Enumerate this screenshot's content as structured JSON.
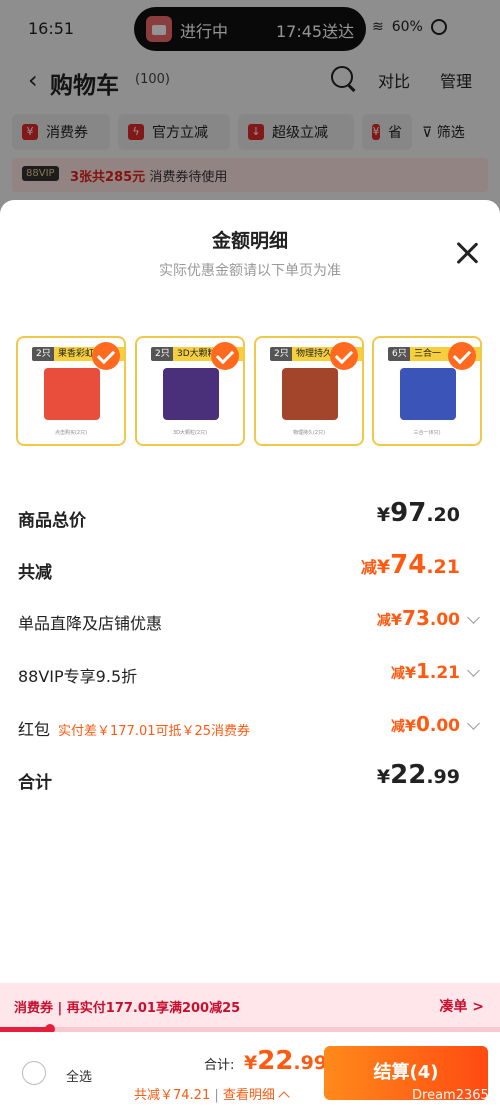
{
  "status_bar": {
    "time": "16:51",
    "live_status": "进行中",
    "eta": "17:45送达",
    "battery": "60%"
  },
  "nav": {
    "title": "购物车",
    "count": "(100)",
    "compare": "对比",
    "manage": "管理"
  },
  "filters": {
    "chips": [
      "消费券",
      "官方立减",
      "超级立减",
      "省"
    ],
    "filter_label": "筛选"
  },
  "vip_banner": {
    "tag": "88VIP",
    "highlight": "3张共285元",
    "text": "消费券待使用"
  },
  "sheet": {
    "title": "金额明细",
    "subtitle": "实际优惠金额请以下单页为准",
    "products": [
      {
        "qty": "2只",
        "name": "果香彩虹",
        "caption": "点击购买(2只)",
        "color": "#e94e3c"
      },
      {
        "qty": "2只",
        "name": "3D大颗粒",
        "caption": "3D大颗粒(2只)",
        "color": "#4a2f7a"
      },
      {
        "qty": "2只",
        "name": "物理持久",
        "caption": "物理持久(2只)",
        "color": "#a2452a"
      },
      {
        "qty": "6只",
        "name": "三合一",
        "caption": "三合一(6只)",
        "color": "#3a54b8"
      }
    ],
    "rows": [
      {
        "label": "商品总价",
        "prefix": "",
        "yen": "¥",
        "int": "97",
        "dec": ".20",
        "style": "dark"
      },
      {
        "label": "共减",
        "prefix": "减",
        "yen": "¥",
        "int": "74",
        "dec": ".21",
        "style": "orange"
      },
      {
        "label": "单品直降及店铺优惠",
        "prefix": "减",
        "yen": "¥",
        "int": "73",
        "dec": ".00",
        "style": "orange-sm"
      },
      {
        "label": "88VIP专享9.5折",
        "prefix": "减",
        "yen": "¥",
        "int": "1",
        "dec": ".21",
        "style": "orange-sm"
      },
      {
        "label": "红包",
        "note": "实付差￥177.01可抵￥25消费券",
        "prefix": "减",
        "yen": "¥",
        "int": "0",
        "dec": ".00",
        "style": "orange-sm"
      },
      {
        "label": "合计",
        "prefix": "",
        "yen": "¥",
        "int": "22",
        "dec": ".99",
        "style": "dark"
      }
    ]
  },
  "coupon_strip": {
    "text": "消费券 | 再实付177.01享满200减25",
    "link": "凑单 >",
    "progress": 0.1
  },
  "bottom_bar": {
    "select_all": "全选",
    "total_label": "合计:",
    "total_yen": "¥",
    "total_int": "22",
    "total_dec": ".99",
    "saved": "共减￥74.21",
    "detail_link": "查看明细",
    "checkout": "结算(4)",
    "watermark": "Dream2365"
  },
  "colors": {
    "accent": "#ff5a12",
    "coupon_red": "#e61e3c",
    "card_border": "#f2c84b"
  },
  "icons": [
    "back-icon",
    "search-icon",
    "close-icon",
    "check-icon",
    "chevron-down-icon",
    "chevron-up-icon",
    "filter-icon",
    "wifi-icon"
  ]
}
